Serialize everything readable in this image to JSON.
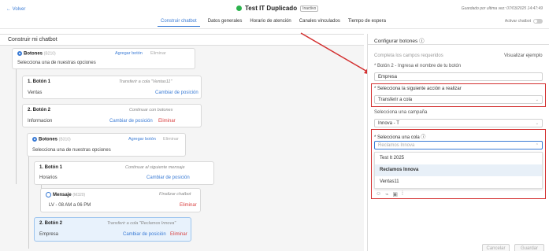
{
  "header": {
    "back": "← Volver",
    "title": "Test IT Duplicado",
    "status": "Inactivo",
    "saved": "Guardado por ultima vez: 07/03/2025 14:47:49",
    "tabs": [
      "Construir chatbot",
      "Datos generales",
      "Horario de atención",
      "Canales vinculados",
      "Tiempo de espera"
    ],
    "toggle_label": "Activar chatbot"
  },
  "left": {
    "title": "Construir mi chatbot",
    "cards": [
      {
        "title": "Botones",
        "code": "(B210)",
        "sub": "Selecciona una de nuestras opciones",
        "a1": "Agregar botón",
        "a2": "Eliminar"
      },
      {
        "title": "1. Botón 1",
        "sub": "Ventas",
        "note": "Transferir a cola \"Ventas11\"",
        "a1": "Cambiar de posición"
      },
      {
        "title": "2. Botón 2",
        "sub": "Informacion",
        "note": "Continuar con botones",
        "a1": "Cambiar de posición",
        "a2": "Eliminar"
      },
      {
        "title": "Botones",
        "code": "(B310)",
        "sub": "Selecciona una de nuestras opciones",
        "a1": "Agregar botón",
        "a2": "Eliminar"
      },
      {
        "title": "1. Botón 1",
        "sub": "Horarios",
        "note": "Continuar al siguiente mensaje",
        "a1": "Cambiar de posición"
      },
      {
        "title": "Mensaje",
        "code": "(M320)",
        "sub": "LV - 08 AM a 06 PM",
        "note": "Finalizar chatbot",
        "a2": "Eliminar"
      },
      {
        "title": "2. Botón 2",
        "sub": "Empresa",
        "note": "Transferir a cola \"Reclamos Innova\"",
        "a1": "Cambiar de posición",
        "a2": "Eliminar"
      }
    ]
  },
  "right": {
    "title": "Configurar botones ⓘ",
    "required": "Completa los campos requeridos",
    "preview": "Visualizar ejemplo",
    "label1": "* Botón 2 - Ingresa el nombre de tu botón",
    "value1": "Empresa",
    "label2": "* Selecciona la siguiente acción a realizar",
    "value2": "Transferir a cola",
    "label3": "Selecciona una campaña",
    "value3": "Innova - T",
    "label4": "* Selecciona una cola",
    "placeholder4": "Reclamos Innova",
    "options": [
      "Test It 2025",
      "Reclamos Innova",
      "Ventas11"
    ],
    "cancel": "Cancelar",
    "save": "Guardar"
  }
}
